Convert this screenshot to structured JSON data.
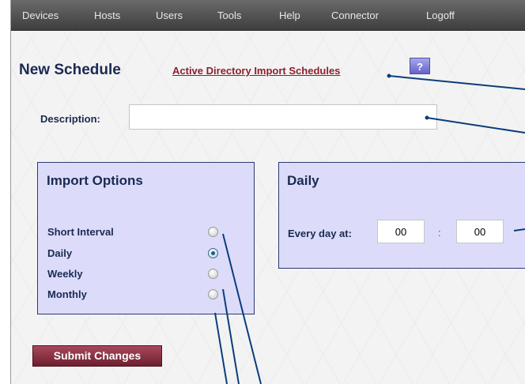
{
  "nav": {
    "items": [
      {
        "label": "Devices"
      },
      {
        "label": "Hosts"
      },
      {
        "label": "Users"
      },
      {
        "label": "Tools"
      },
      {
        "label": "Help"
      },
      {
        "label": "Connector"
      },
      {
        "label": "Logoff"
      }
    ]
  },
  "header": {
    "title": "New Schedule",
    "link_label": "Active Directory Import Schedules",
    "help_label": "?"
  },
  "description": {
    "label": "Description:",
    "value": "",
    "placeholder": ""
  },
  "import_options": {
    "title": "Import Options",
    "options": [
      {
        "label": "Short Interval",
        "checked": false
      },
      {
        "label": "Daily",
        "checked": true
      },
      {
        "label": "Weekly",
        "checked": false
      },
      {
        "label": "Monthly",
        "checked": false
      }
    ]
  },
  "daily": {
    "title": "Daily",
    "label": "Every day at:",
    "hour": "00",
    "separator": ":",
    "minute": "00"
  },
  "actions": {
    "submit_label": "Submit Changes"
  },
  "colors": {
    "panel_bg": "#dcdcfa",
    "heading": "#1a2a52",
    "link": "#8e1f2c",
    "submit": "#8a2f42",
    "callout_line": "#0b3d7a"
  }
}
